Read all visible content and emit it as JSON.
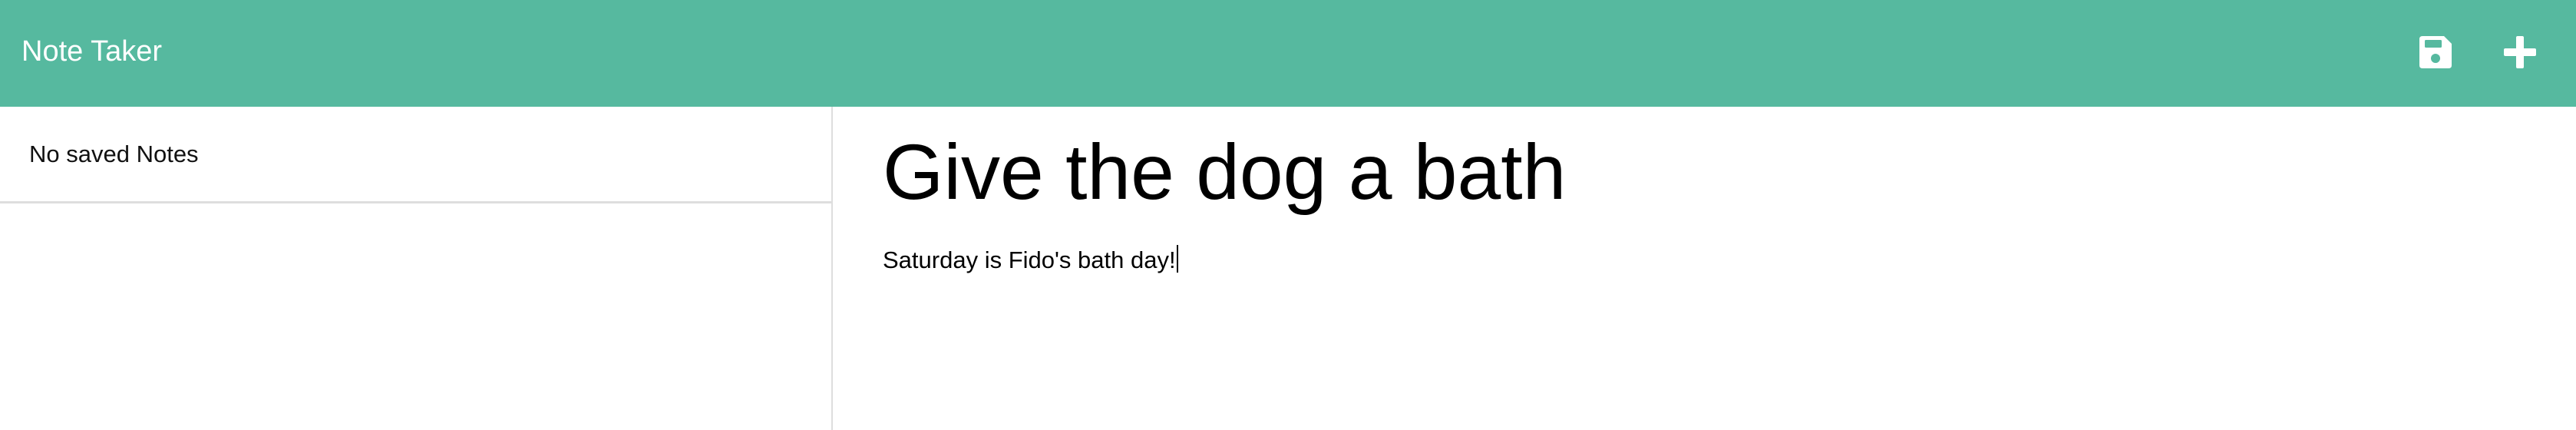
{
  "navbar": {
    "brand": "Note Taker",
    "background_color": "#56b99f",
    "icons": [
      {
        "name": "save-icon",
        "label": "Save Note"
      },
      {
        "name": "plus-icon",
        "label": "New Note"
      }
    ]
  },
  "sidebar": {
    "empty_message": "No saved Notes"
  },
  "editor": {
    "title_value": "Give the dog a bath",
    "body_value": "Saturday is Fido's bath day!"
  }
}
